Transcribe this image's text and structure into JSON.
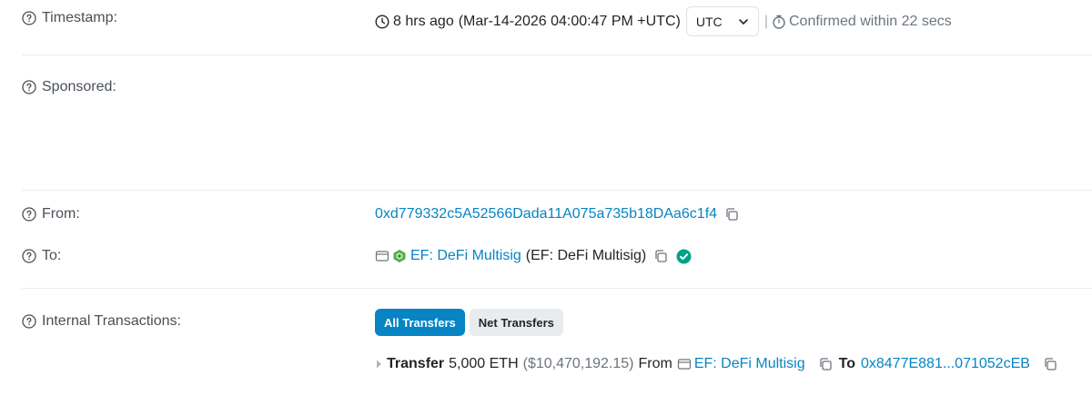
{
  "timestamp": {
    "label": "Timestamp:",
    "relative": "8 hrs ago",
    "absolute": "(Mar-14-2026 04:00:47 PM +UTC)",
    "timezone": "UTC",
    "separator": "|",
    "confirmed": "Confirmed within 22 secs"
  },
  "sponsored": {
    "label": "Sponsored:"
  },
  "from": {
    "label": "From:",
    "address": "0xd779332c5A52566Dada11A075a735b18DAa6c1f4"
  },
  "to": {
    "label": "To:",
    "name": "EF: DeFi Multisig",
    "name_paren": "(EF: DeFi Multisig)"
  },
  "internal": {
    "label": "Internal Transactions:",
    "tabs": [
      "All Transfers",
      "Net Transfers"
    ],
    "transfer": {
      "word": "Transfer",
      "amount": "5,000 ETH",
      "usd": "($10,470,192.15)",
      "from_word": "From",
      "from_name": "EF: DeFi Multisig",
      "to_word": "To",
      "to_address": "0x8477E881...071052cEB"
    }
  },
  "colors": {
    "link": "#0784c3",
    "accent_active": "#0784c3",
    "verified": "#00a186",
    "muted": "#6c757d"
  }
}
